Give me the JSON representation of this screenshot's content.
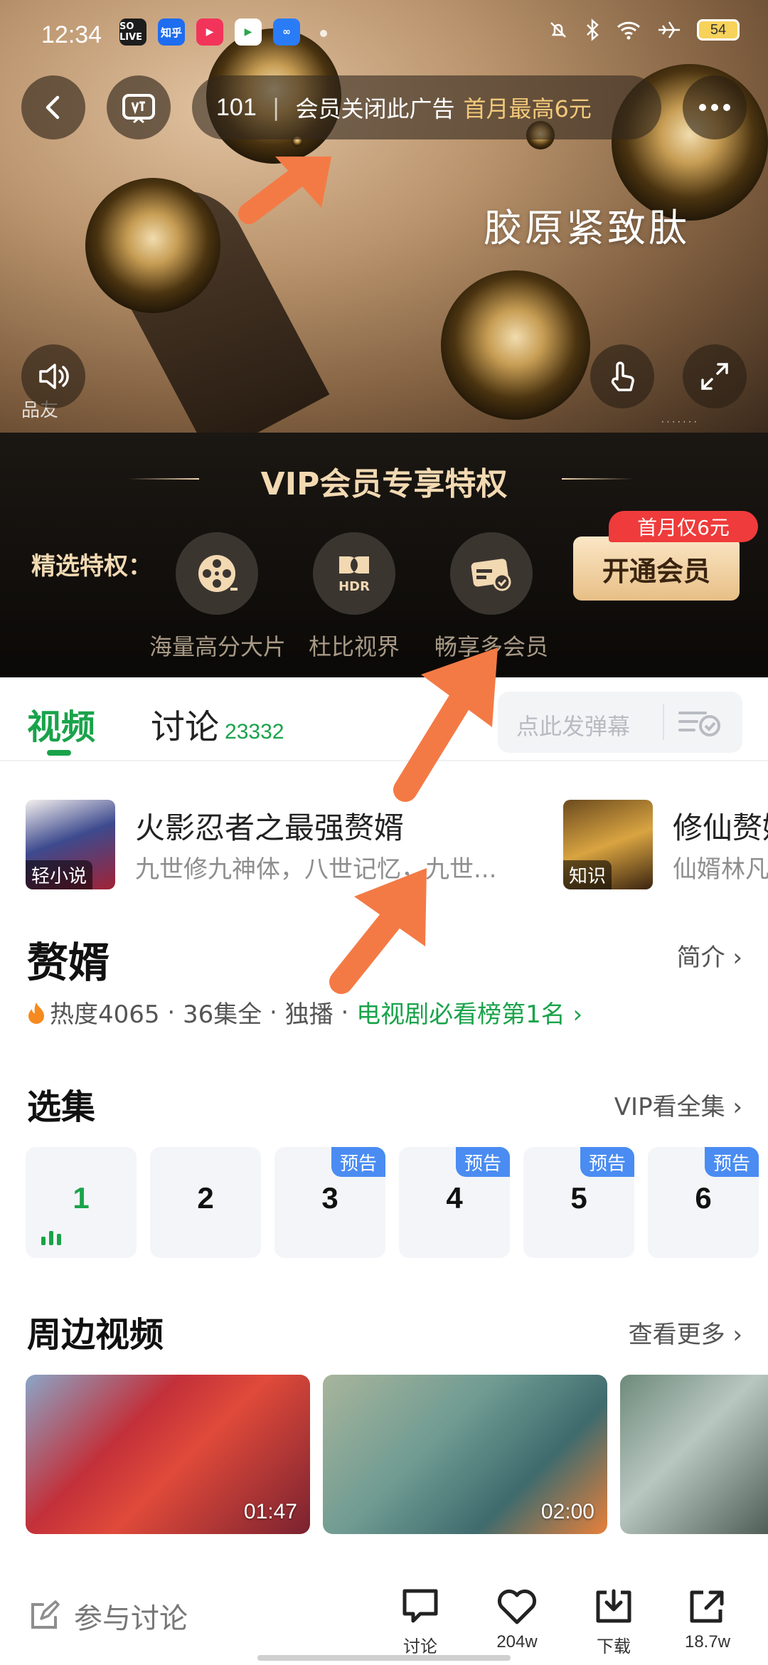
{
  "status_bar": {
    "time": "12:34",
    "apps": [
      "SO LIVE",
      "知乎",
      "",
      "",
      ""
    ],
    "battery": "54"
  },
  "ad": {
    "countdown": "101",
    "close_text": "会员关闭此广告",
    "promo_text": "首月最高6元",
    "overlay_text": "胶原紧致肽",
    "brand_text": "品友"
  },
  "vip": {
    "title": "VIP会员专享特权",
    "label": "精选特权：",
    "perks": [
      {
        "label": "海量高分大片",
        "icon": "film-reel-icon"
      },
      {
        "label": "杜比视界",
        "icon": "dolby-hdr-icon"
      },
      {
        "label": "畅享多会员",
        "icon": "membership-card-icon"
      }
    ],
    "join_button": "开通会员",
    "join_tag": "首月仅6元"
  },
  "tabs": {
    "video": "视频",
    "discuss": "讨论",
    "discuss_count": "23332",
    "danmu_placeholder": "点此发弹幕"
  },
  "recommendations": [
    {
      "tag": "轻小说",
      "title": "火影忍者之最强赘婿",
      "desc": "九世修九神体，八世记忆，九世..."
    },
    {
      "tag": "知识",
      "title": "修仙赘婿",
      "desc": "仙婿林凡"
    }
  ],
  "drama": {
    "title": "赘婿",
    "intro_link": "简介",
    "heat": "热度4065",
    "episodes_info": "36集全",
    "exclusive": "独播",
    "rank": "电视剧必看榜第1名"
  },
  "episodes": {
    "title": "选集",
    "link": "VIP看全集",
    "items": [
      {
        "num": "1",
        "badge": ""
      },
      {
        "num": "2",
        "badge": ""
      },
      {
        "num": "3",
        "badge": "预告"
      },
      {
        "num": "4",
        "badge": "预告"
      },
      {
        "num": "5",
        "badge": "预告"
      },
      {
        "num": "6",
        "badge": "预告"
      }
    ]
  },
  "related": {
    "title": "周边视频",
    "link": "查看更多",
    "videos": [
      {
        "duration": "01:47"
      },
      {
        "duration": "02:00"
      },
      {
        "duration": ""
      }
    ]
  },
  "bottom_bar": {
    "comment_entry": "参与讨论",
    "items": [
      {
        "label": "讨论",
        "icon": "comment-icon"
      },
      {
        "label": "204w",
        "icon": "heart-icon"
      },
      {
        "label": "下载",
        "icon": "download-icon"
      },
      {
        "label": "18.7w",
        "icon": "share-icon"
      }
    ]
  },
  "colors": {
    "accent_green": "#19a34a",
    "vip_gold": "#f2d9b2",
    "promo_red": "#ef3b3b",
    "badge_blue": "#4a8cf2",
    "annotation_orange": "#f47a45"
  }
}
